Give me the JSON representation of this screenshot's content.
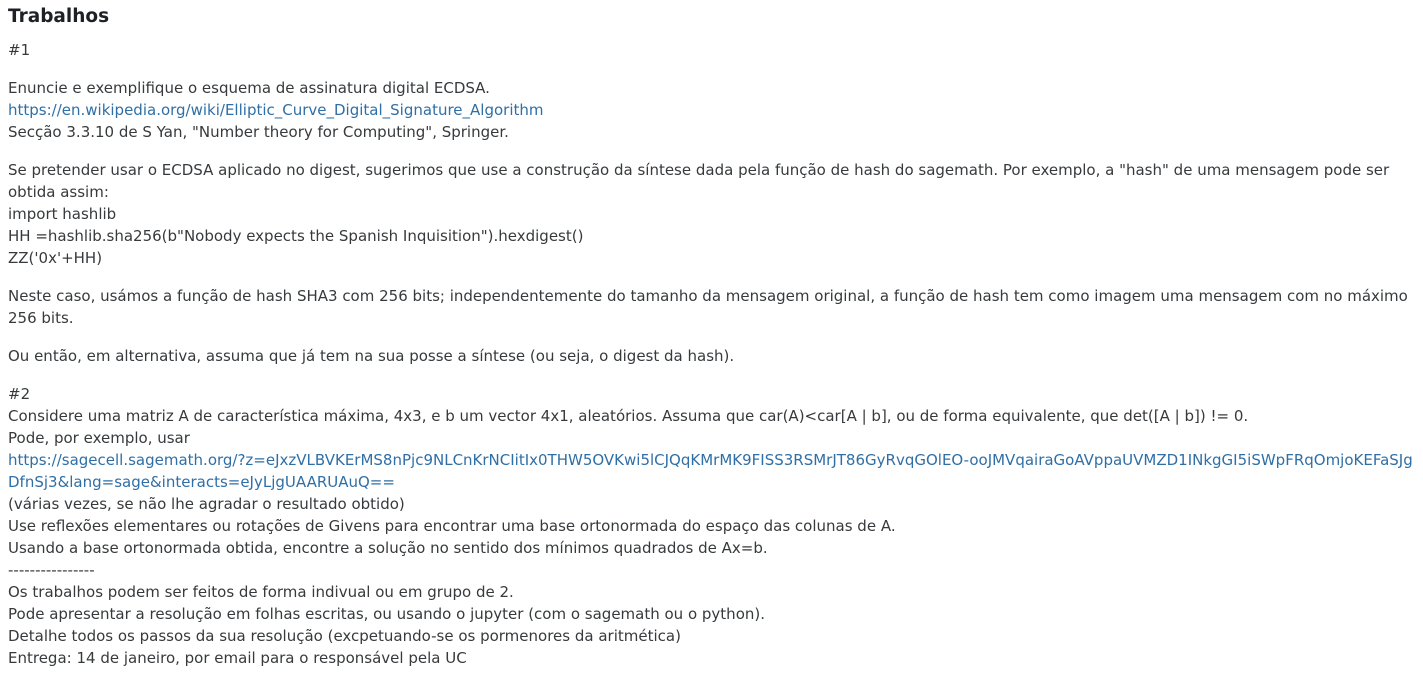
{
  "section": {
    "title": "Trabalhos"
  },
  "work1": {
    "heading": "#1",
    "p1": [
      "Enuncie e exemplifique o esquema de assinatura digital ECDSA.",
      "https://en.wikipedia.org/wiki/Elliptic_Curve_Digital_Signature_Algorithm",
      "Secção 3.3.10 de S Yan, \"Number theory for Computing\", Springer."
    ],
    "p2": [
      "Se pretender usar o ECDSA aplicado no digest, sugerimos que use a construção da síntese dada pela função de hash do sagemath. Por exemplo, a \"hash\" de uma mensagem pode ser obtida assim:",
      "import hashlib",
      "HH =hashlib.sha256(b\"Nobody expects the Spanish Inquisition\").hexdigest()",
      "ZZ('0x'+HH)"
    ],
    "p3": "Neste caso, usámos a função de hash SHA3 com 256 bits; independentemente do tamanho da mensagem original, a função de hash tem como imagem uma mensagem com no máximo 256 bits.",
    "p4": "Ou então, em alternativa, assuma que já tem na sua posse a síntese (ou seja, o digest da hash)."
  },
  "work2": {
    "heading": "#2",
    "line1": "Considere uma matriz A de característica máxima, 4x3, e b um vector 4x1, aleatórios. Assuma que car(A)<car[A | b], ou de forma equivalente, que det([A | b]) != 0.",
    "line2": "Pode, por exemplo, usar",
    "link": "https://sagecell.sagemath.org/?z=eJxzVLBVKErMS8nPjc9NLCnKrNCIitIx0THW5OVKwi5lCJQqKMrMK9FISS3RSMrJT86GyRvqGOlEO-ooJMVqairaGoAVppaUVMZD1INkgGI5iSWpFRqOmjoKEFaSJgDfnSj3&lang=sage&interacts=eJyLjgUAARUAuQ==",
    "line3": "(várias vezes, se não lhe agradar o resultado obtido)",
    "line4": "Use reflexões elementares ou rotações de Givens para encontrar uma base ortonormada do espaço das colunas de A.",
    "line5": "Usando a base ortonormada obtida, encontre a solução no sentido dos mínimos quadrados de Ax=b.",
    "separator": "----------------",
    "line6": "Os trabalhos podem ser feitos de forma indivual ou em grupo de 2.",
    "line7": "Pode apresentar a resolução em folhas escritas, ou usando o jupyter (com o sagemath ou o python).",
    "line8": "Detalhe todos os passos da sua resolução (excpetuando-se os pormenores da aritmética)",
    "line9": "Entrega: 14 de janeiro, por email para o responsável pela UC"
  },
  "colors": {
    "text": "#373a3c",
    "link": "#2f6fa6",
    "background": "#ffffff"
  }
}
